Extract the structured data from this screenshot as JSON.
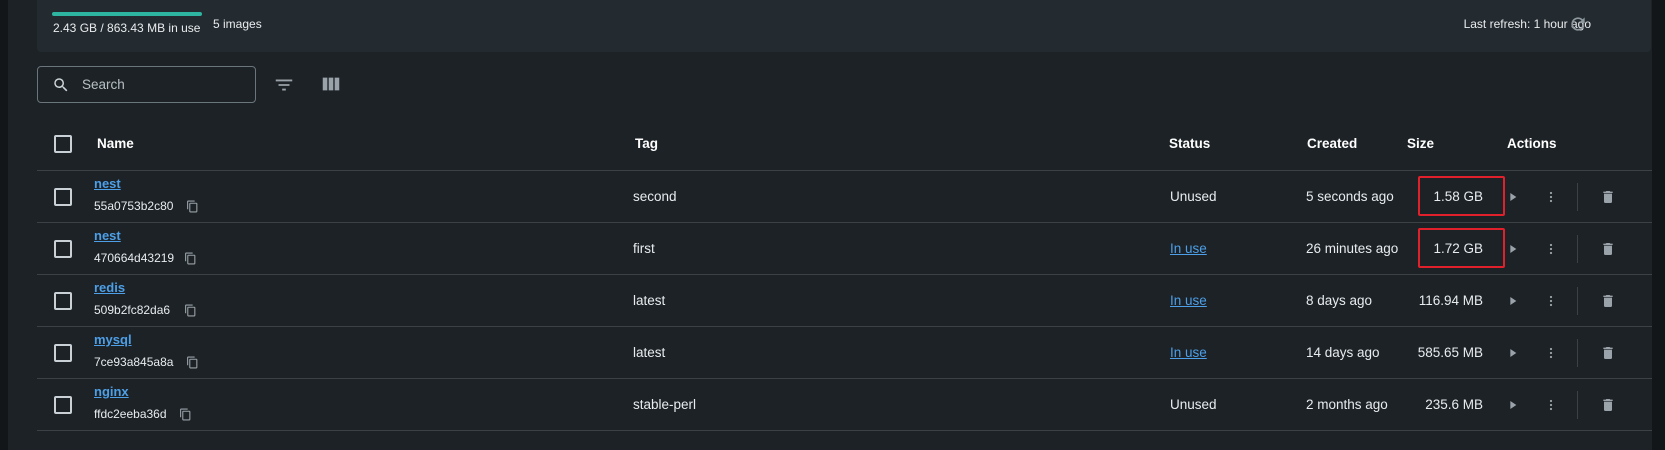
{
  "usage": {
    "progress_fraction": 1,
    "text": "2.43 GB / 863.43 MB in use",
    "images_count": "5 images",
    "last_refresh": "Last refresh: 1 hour ago"
  },
  "toolbar": {
    "search_placeholder": "Search"
  },
  "table": {
    "headers": {
      "name": "Name",
      "tag": "Tag",
      "status": "Status",
      "created": "Created",
      "size": "Size",
      "actions": "Actions"
    },
    "rows": [
      {
        "name": "nest",
        "id": "55a0753b2c80",
        "tag": "second",
        "status": "Unused",
        "in_use": false,
        "created": "5 seconds ago",
        "size": "1.58 GB",
        "highlighted": true
      },
      {
        "name": "nest",
        "id": "470664d43219",
        "tag": "first",
        "status": "In use",
        "in_use": true,
        "created": "26 minutes ago",
        "size": "1.72 GB",
        "highlighted": true
      },
      {
        "name": "redis",
        "id": "509b2fc82da6",
        "tag": "latest",
        "status": "In use",
        "in_use": true,
        "created": "8 days ago",
        "size": "116.94 MB",
        "highlighted": false
      },
      {
        "name": "mysql",
        "id": "7ce93a845a8a",
        "tag": "latest",
        "status": "In use",
        "in_use": true,
        "created": "14 days ago",
        "size": "585.65 MB",
        "highlighted": false
      },
      {
        "name": "nginx",
        "id": "ffdc2eeba36d",
        "tag": "stable-perl",
        "status": "Unused",
        "in_use": false,
        "created": "2 months ago",
        "size": "235.6 MB",
        "highlighted": false
      }
    ]
  },
  "colors": {
    "accent": "#2eb5a2",
    "link": "#4d9fe8",
    "highlight": "#e0202a"
  }
}
